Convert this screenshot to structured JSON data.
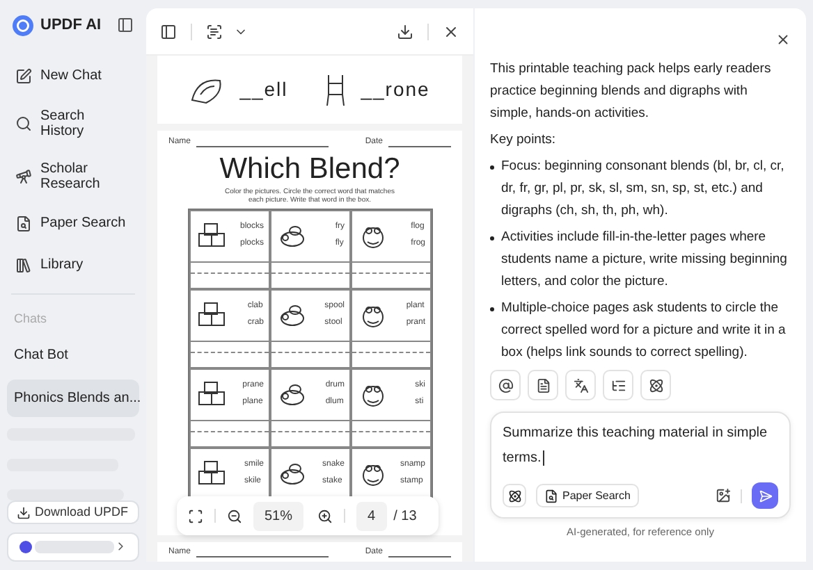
{
  "app": {
    "name": "UPDF AI"
  },
  "sidebar": {
    "nav": [
      {
        "label": "New Chat",
        "kind": "new-chat"
      },
      {
        "label": "Search History",
        "kind": "history"
      },
      {
        "label": "Scholar Research",
        "kind": "scholar"
      },
      {
        "label": "Paper Search",
        "kind": "paper"
      },
      {
        "label": "Library",
        "kind": "library"
      }
    ],
    "chats_heading": "Chats",
    "chats": [
      {
        "label": "Chat Bot",
        "selected": false
      },
      {
        "label": "Phonics Blends an...",
        "selected": true
      }
    ],
    "download_button": "Download UPDF"
  },
  "document": {
    "previous_page": {
      "fill_ins": [
        {
          "text": "__ell",
          "kind": "shell"
        },
        {
          "text": "__rone",
          "kind": "throne"
        }
      ]
    },
    "worksheet": {
      "name_label": "Name",
      "date_label": "Date",
      "title": "Which Blend?",
      "instructions": "Color the pictures. Circle the correct word that matches each picture. Write that word in the box.",
      "cells": [
        {
          "options": [
            "blocks",
            "plocks"
          ]
        },
        {
          "options": [
            "fry",
            "fly"
          ]
        },
        {
          "options": [
            "flog",
            "frog"
          ]
        },
        {
          "options": [
            "clab",
            "crab"
          ]
        },
        {
          "options": [
            "spool",
            "stool"
          ]
        },
        {
          "options": [
            "plant",
            "prant"
          ]
        },
        {
          "options": [
            "prane",
            "plane"
          ]
        },
        {
          "options": [
            "drum",
            "dlum"
          ]
        },
        {
          "options": [
            "ski",
            "sti"
          ]
        },
        {
          "options": [
            "smile",
            "skile"
          ]
        },
        {
          "options": [
            "snake",
            "stake"
          ]
        },
        {
          "options": [
            "snamp",
            "stamp"
          ]
        }
      ]
    },
    "next_page": {
      "name_label": "Name",
      "date_label": "Date"
    },
    "zoom": "51%",
    "page": "4",
    "page_total": "/ 13"
  },
  "chat": {
    "intro": "This printable teaching pack helps early readers practice beginning blends and digraphs with simple, hands-on activities.",
    "key_points_heading": "Key points:",
    "bullets": [
      "Focus: beginning consonant blends (bl, br, cl, cr, dr, fr, gr, pl, pr, sk, sl, sm, sn, sp, st, etc.) and digraphs (ch, sh, th, ph, wh).",
      "Activities include fill-in-the-letter pages where students name a picture, write missing beginning letters, and color the picture.",
      "Multiple-choice pages ask students to circle the correct spelled word for a picture and write it in a box (helps link sounds to correct spelling)."
    ],
    "input_value": "Summarize this teaching material in simple terms.",
    "paper_search_button": "Paper Search",
    "disclaimer": "AI-generated, for reference only"
  }
}
